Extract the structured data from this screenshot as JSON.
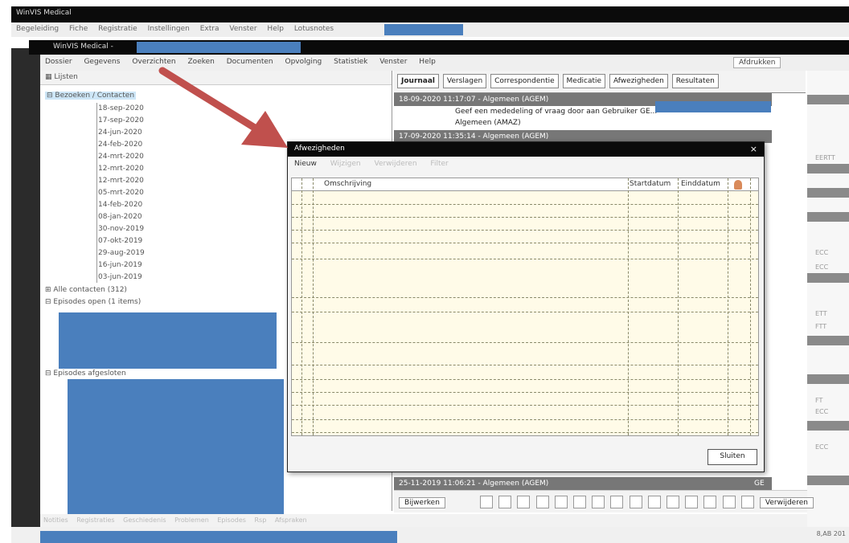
{
  "outer_window": {
    "title": "WinVIS Medical",
    "menu": [
      "Begeleiding",
      "Fiche",
      "Registratie",
      "Instellingen",
      "Extra",
      "Venster",
      "Help",
      "Lotusnotes"
    ]
  },
  "inner_window": {
    "title": "WinVIS Medical - ",
    "menu": [
      "Dossier",
      "Gegevens",
      "Overzichten",
      "Zoeken",
      "Documenten",
      "Opvolging",
      "Statistiek",
      "Venster",
      "Help"
    ],
    "right_button": "Afdrukken"
  },
  "tree": {
    "toolbar_label": "Lijsten",
    "root_label": "Bezoeken / Contacten",
    "dates": [
      "18-sep-2020",
      "17-sep-2020",
      "24-jun-2020",
      "24-feb-2020",
      "24-mrt-2020",
      "12-mrt-2020",
      "12-mrt-2020",
      "05-mrt-2020",
      "14-feb-2020",
      "08-jan-2020",
      "30-nov-2019",
      "07-okt-2019",
      "29-aug-2019",
      "16-jun-2019",
      "03-jun-2019"
    ],
    "all_contacts": "Alle contacten (312)",
    "episodes_open": "Episodes open (1 items)",
    "episodes_closed": "Episodes afgesloten"
  },
  "tabs": [
    "Journaal",
    "Verslagen",
    "Correspondentie",
    "Medicatie",
    "Afwezigheden",
    "Resultaten"
  ],
  "journal": {
    "row1": "18-09-2020    11:17:07 - Algemeen (AGEM)",
    "row1_text": "Geef een mededeling of vraag door aan Gebruiker GE...",
    "row1_sub": "Algemeen (AMAZ)",
    "row2": "17-09-2020    11:35:14 - Algemeen (AGEM)",
    "row_bottom": "25-11-2019    11:06:21 - Algemeen (AGEM)",
    "row_bottom_right": "GE"
  },
  "bottom_toolbar": {
    "left_button": "Bijwerken",
    "right_button": "Verwijderen"
  },
  "status_tabs": [
    "Notities",
    "Registraties",
    "Geschiedenis",
    "Problemen",
    "Episodes",
    "Rsp",
    "Afspraken"
  ],
  "far_right_texts": [
    "EERTT",
    "ECC",
    "ECC",
    "ETT",
    "FTT",
    "FT",
    "ECC",
    "ECC"
  ],
  "statusbar_right": "8,AB 201",
  "dialog": {
    "title": "Afwezigheden",
    "close": "×",
    "toolbar": [
      "Nieuw",
      "Wijzigen",
      "Verwijderen",
      "Filter"
    ],
    "columns": [
      "Omschrijving",
      "Startdatum",
      "Einddatum"
    ],
    "ok_button": "Sluiten"
  },
  "colors": {
    "redaction": "#4a7fbd",
    "arrow": "#c0504d",
    "grid_bg": "#fffbe8"
  }
}
